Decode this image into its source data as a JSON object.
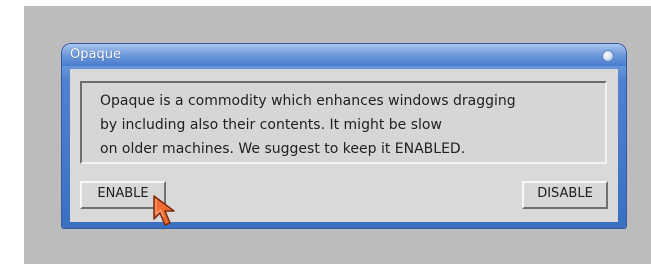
{
  "window": {
    "title": "Opaque"
  },
  "message": {
    "lines": [
      "Opaque is a commodity which enhances windows dragging",
      "by including also their contents. It might be slow",
      "on older machines. We suggest to keep it ENABLED."
    ]
  },
  "buttons": {
    "enable": "ENABLE",
    "disable": "DISABLE"
  },
  "icons": {
    "title_button": "window-button-icon",
    "cursor": "mouse-pointer-icon"
  },
  "colors": {
    "desktop": "#bcbcbc",
    "title_bar": "#4f82cf",
    "content": "#d9d9d9"
  }
}
